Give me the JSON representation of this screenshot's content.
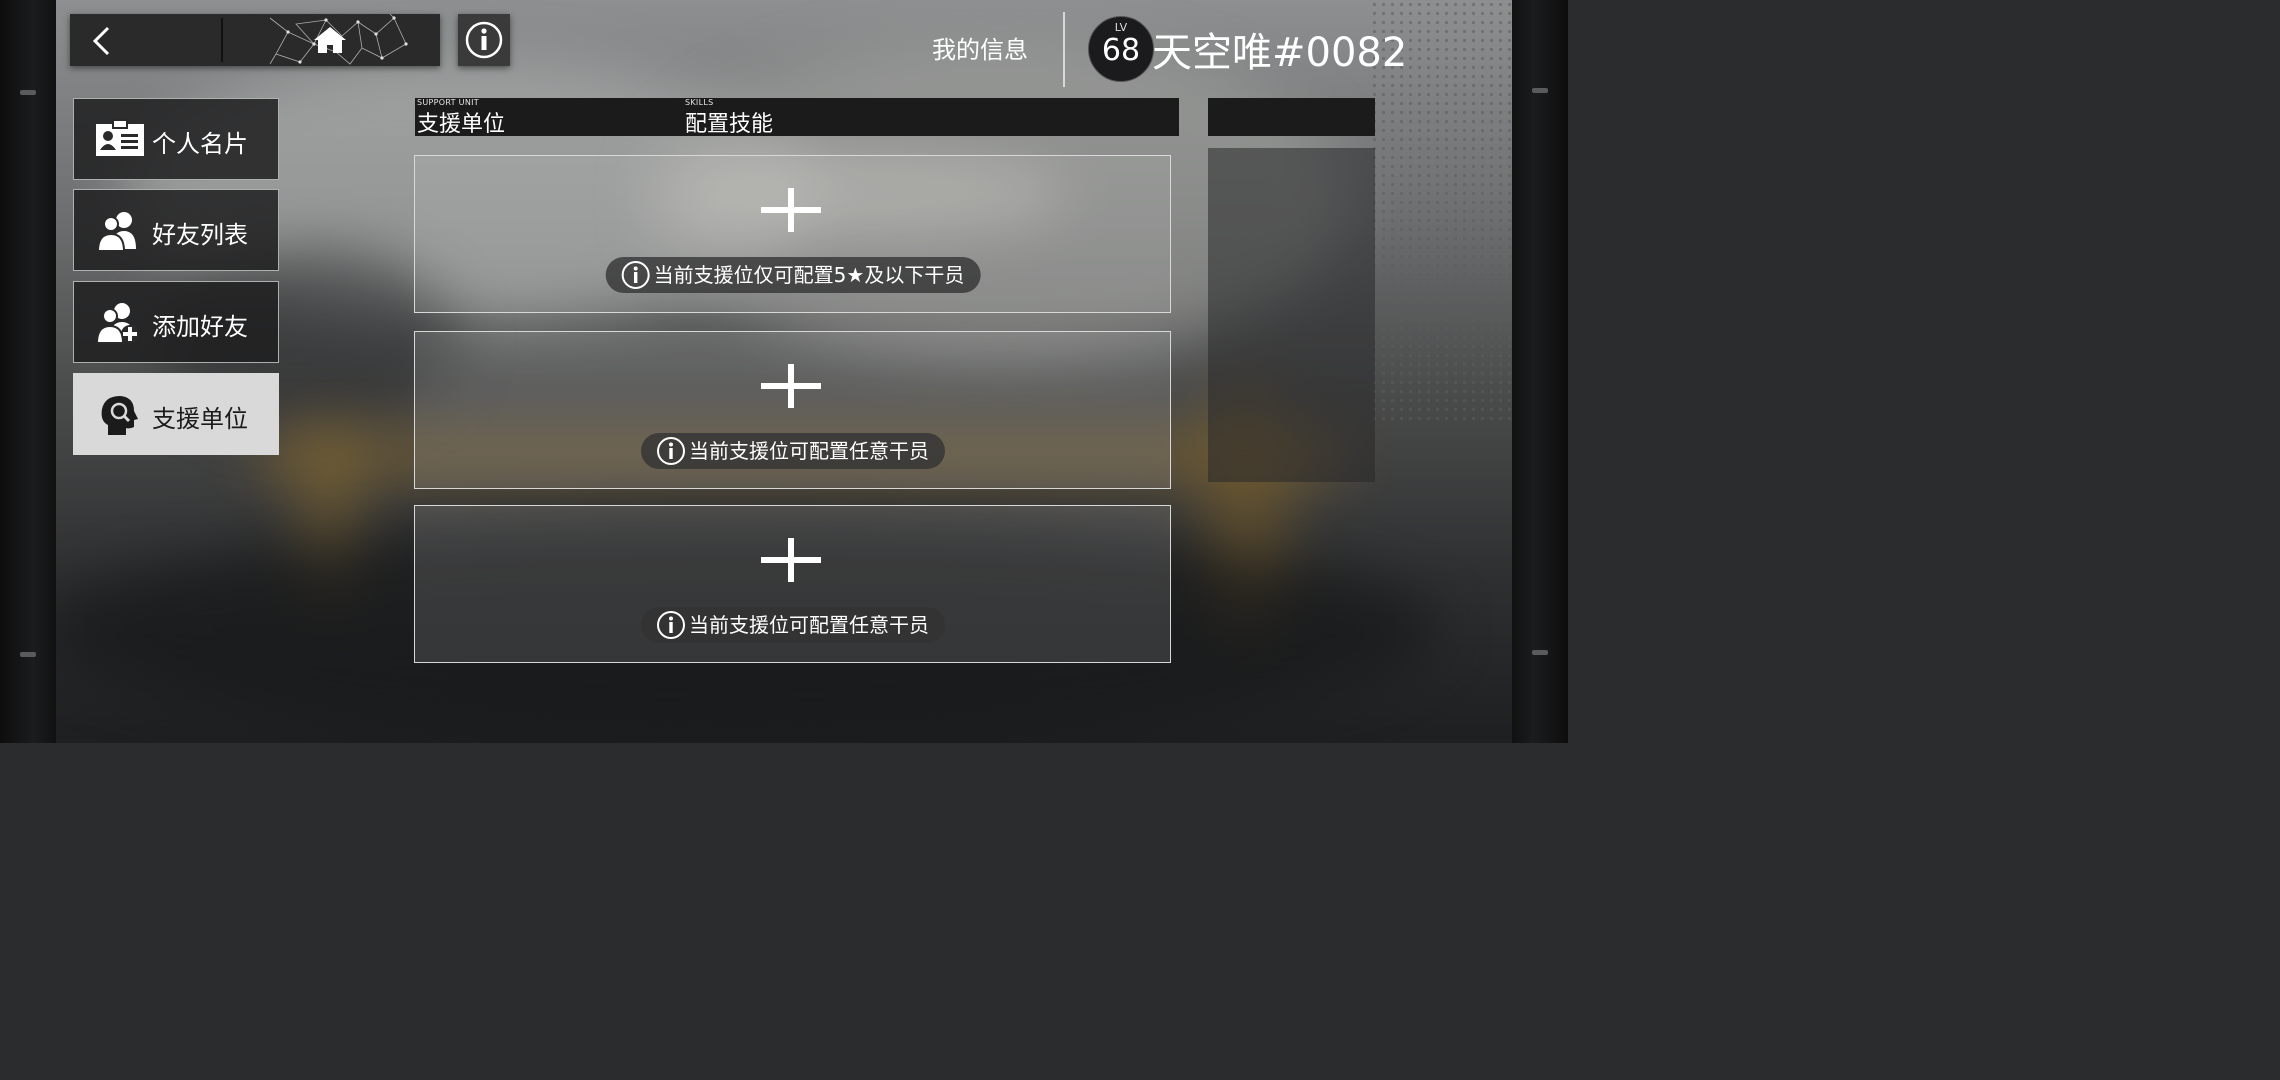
{
  "header": {
    "back_icon": "chevron-left-icon",
    "home_icon": "home-icon",
    "info_icon": "info-icon",
    "my_info_label": "我的信息",
    "level_label": "LV",
    "level_value": "68",
    "player_name": "天空唯#0082"
  },
  "sidebar": {
    "items": [
      {
        "label": "个人名片",
        "icon": "id-card-icon",
        "active": false
      },
      {
        "label": "好友列表",
        "icon": "friends-icon",
        "active": false
      },
      {
        "label": "添加好友",
        "icon": "add-friend-icon",
        "active": false
      },
      {
        "label": "支援单位",
        "icon": "support-unit-icon",
        "active": true
      }
    ]
  },
  "table": {
    "columns": [
      {
        "small": "SUPPORT UNIT",
        "label": "支援单位"
      },
      {
        "small": "SKILLS",
        "label": "配置技能"
      }
    ]
  },
  "slots": [
    {
      "icon": "plus-icon",
      "note_icon": "info-icon",
      "note": "当前支援位仅可配置5★及以下干员"
    },
    {
      "icon": "plus-icon",
      "note_icon": "info-icon",
      "note": "当前支援位可配置任意干员"
    },
    {
      "icon": "plus-icon",
      "note_icon": "info-icon",
      "note": "当前支援位可配置任意干员"
    }
  ],
  "colors": {
    "panel_dark": "#1b1b1c",
    "menu_active_bg": "#d9d9d9",
    "slot_border": "#d8d8d8"
  }
}
